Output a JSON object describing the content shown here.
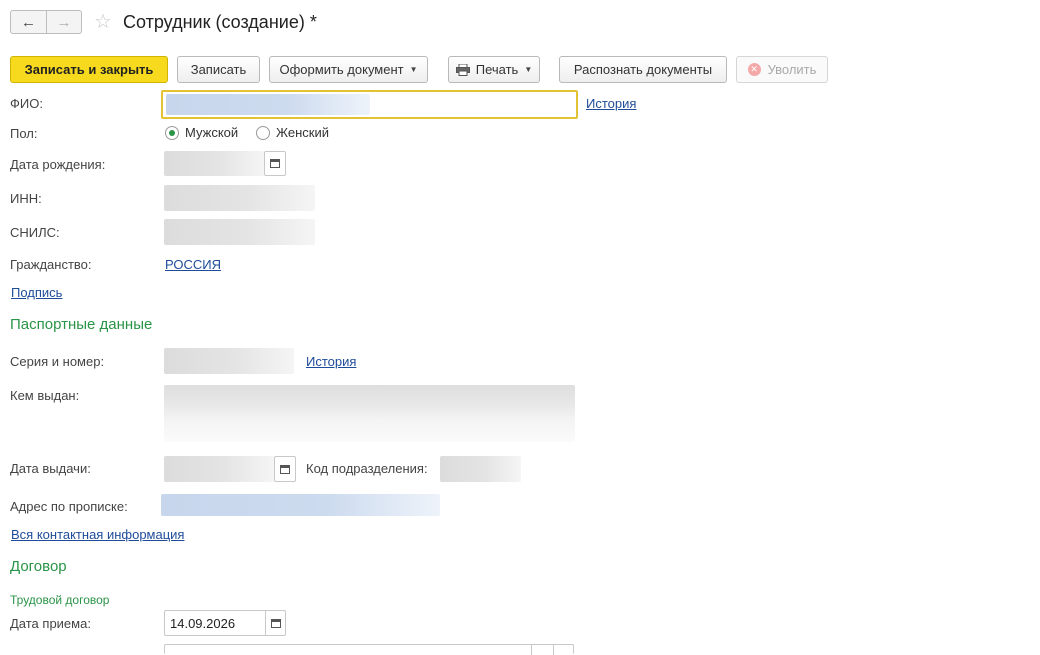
{
  "window": {
    "title": "Сотрудник (создание) *",
    "nav_back": "←",
    "nav_forward": "→",
    "star": "☆"
  },
  "toolbar": {
    "save_close": "Записать и закрыть",
    "save": "Записать",
    "make_document": "Оформить документ",
    "print": "Печать",
    "recognize": "Распознать документы",
    "dismiss": "Уволить",
    "caret": "▼"
  },
  "form": {
    "fio_label": "ФИО:",
    "fio_history": "История",
    "sex_label": "Пол:",
    "sex_options": [
      "Мужской",
      "Женский"
    ],
    "sex_selected": "Мужской",
    "birth_label": "Дата рождения:",
    "inn_label": "ИНН:",
    "snils_label": "СНИЛС:",
    "citizenship_label": "Гражданство:",
    "citizenship_value": "РОССИЯ",
    "signature_link": "Подпись"
  },
  "passport": {
    "heading": "Паспортные данные",
    "series_label": "Серия и номер:",
    "series_history": "История",
    "issued_by_label": "Кем выдан:",
    "issue_date_label": "Дата выдачи:",
    "dept_code_label": "Код подразделения:",
    "address_label": "Адрес по прописке:",
    "contacts_link": "Вся контактная информация"
  },
  "contract": {
    "heading": "Договор",
    "subheading": "Трудовой договор",
    "hire_date_label": "Дата приема:",
    "hire_date_value": "14.09.2026"
  },
  "colors": {
    "primary_button": "#f7da1d",
    "section_heading": "#2a9447",
    "link": "#1f4c9a",
    "focused_border": "#e3c333"
  }
}
